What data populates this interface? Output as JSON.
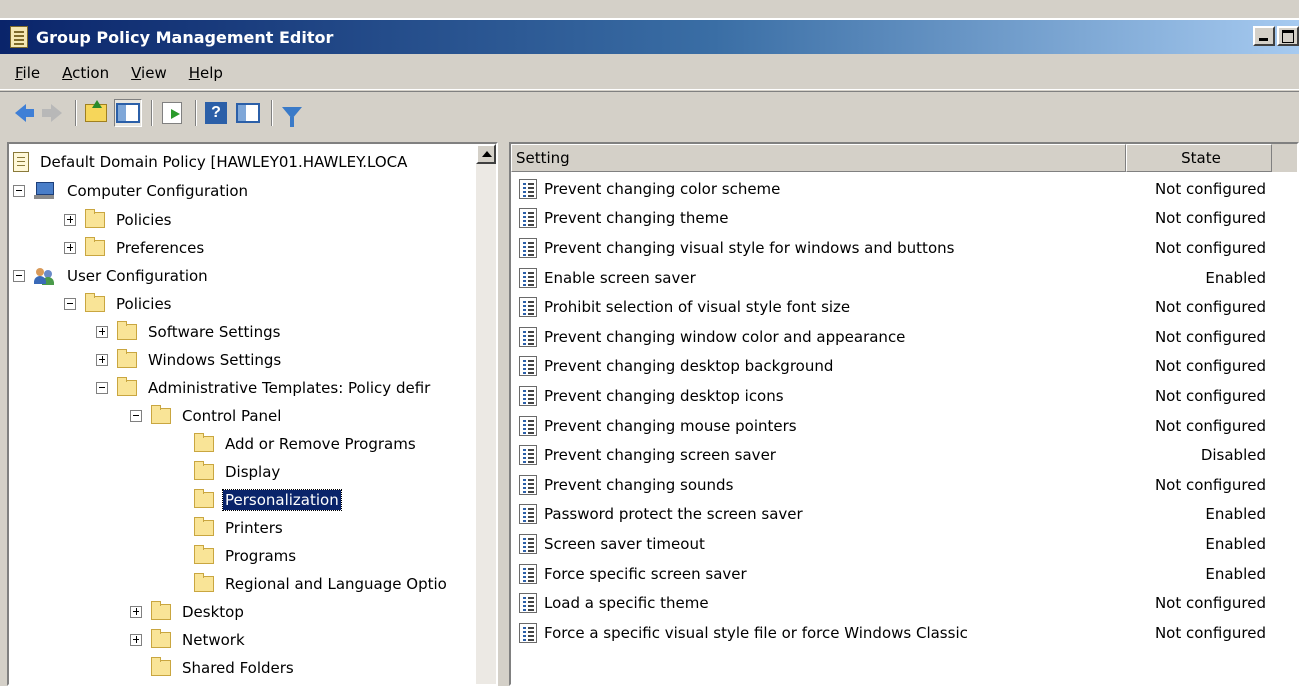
{
  "window": {
    "title": "Group Policy Management Editor"
  },
  "menu": [
    {
      "acc": "F",
      "rest": "ile"
    },
    {
      "acc": "A",
      "rest": "ction"
    },
    {
      "acc": "V",
      "rest": "iew"
    },
    {
      "acc": "H",
      "rest": "elp"
    }
  ],
  "toolbar": {
    "buttons": [
      "back-icon",
      "forward-icon",
      "up-one-level-icon",
      "show-hide-console-tree-icon",
      "export-list-icon",
      "help-icon",
      "show-hide-action-pane-icon",
      "filter-icon"
    ]
  },
  "tree": {
    "items": [
      {
        "label": "Default Domain Policy [HAWLEY01.HAWLEY.LOCA",
        "level": 0,
        "expander": "none",
        "icon": "policy-document-icon"
      },
      {
        "label": "Computer Configuration",
        "level": 0,
        "expander": "minus",
        "icon": "computer-icon"
      },
      {
        "label": "Policies",
        "level": 1,
        "expander": "plus",
        "icon": "folder-icon"
      },
      {
        "label": "Preferences",
        "level": 1,
        "expander": "plus",
        "icon": "folder-icon"
      },
      {
        "label": "User Configuration",
        "level": 0,
        "expander": "minus",
        "icon": "users-icon"
      },
      {
        "label": "Policies",
        "level": 1,
        "expander": "minus",
        "icon": "folder-icon"
      },
      {
        "label": "Software Settings",
        "level": 2,
        "expander": "plus",
        "icon": "folder-icon"
      },
      {
        "label": "Windows Settings",
        "level": 2,
        "expander": "plus",
        "icon": "folder-icon"
      },
      {
        "label": "Administrative Templates: Policy defir",
        "level": 2,
        "expander": "minus",
        "icon": "folder-icon"
      },
      {
        "label": "Control Panel",
        "level": 3,
        "expander": "minus",
        "icon": "folder-icon"
      },
      {
        "label": "Add or Remove Programs",
        "level": 4,
        "expander": "none",
        "icon": "folder-icon"
      },
      {
        "label": "Display",
        "level": 4,
        "expander": "none",
        "icon": "folder-icon"
      },
      {
        "label": "Personalization",
        "level": 4,
        "expander": "none",
        "icon": "folder-icon",
        "selected": true
      },
      {
        "label": "Printers",
        "level": 4,
        "expander": "none",
        "icon": "folder-icon"
      },
      {
        "label": "Programs",
        "level": 4,
        "expander": "none",
        "icon": "folder-icon"
      },
      {
        "label": "Regional and Language Optio",
        "level": 4,
        "expander": "none",
        "icon": "folder-icon"
      },
      {
        "label": "Desktop",
        "level": 3,
        "expander": "plus",
        "icon": "folder-icon"
      },
      {
        "label": "Network",
        "level": 3,
        "expander": "plus",
        "icon": "folder-icon"
      },
      {
        "label": "Shared Folders",
        "level": 3,
        "expander": "none",
        "icon": "folder-icon"
      }
    ]
  },
  "list": {
    "columns": {
      "setting": "Setting",
      "state": "State"
    },
    "rows": [
      {
        "setting": "Prevent changing color scheme",
        "state": "Not configured"
      },
      {
        "setting": "Prevent changing theme",
        "state": "Not configured"
      },
      {
        "setting": "Prevent changing visual style for windows and buttons",
        "state": "Not configured"
      },
      {
        "setting": "Enable screen saver",
        "state": "Enabled"
      },
      {
        "setting": "Prohibit selection of visual style font size",
        "state": "Not configured"
      },
      {
        "setting": "Prevent changing window color and appearance",
        "state": "Not configured"
      },
      {
        "setting": "Prevent changing desktop background",
        "state": "Not configured"
      },
      {
        "setting": "Prevent changing desktop icons",
        "state": "Not configured"
      },
      {
        "setting": "Prevent changing mouse pointers",
        "state": "Not configured"
      },
      {
        "setting": "Prevent changing screen saver",
        "state": "Disabled"
      },
      {
        "setting": "Prevent changing sounds",
        "state": "Not configured"
      },
      {
        "setting": "Password protect the screen saver",
        "state": "Enabled"
      },
      {
        "setting": "Screen saver timeout",
        "state": "Enabled"
      },
      {
        "setting": "Force specific screen saver",
        "state": "Enabled"
      },
      {
        "setting": "Load a specific theme",
        "state": "Not configured"
      },
      {
        "setting": "Force a specific visual style file or force Windows Classic",
        "state": "Not configured"
      }
    ]
  },
  "colors": {
    "titlebar": "#0a246a",
    "selection": "#0a246a",
    "chrome": "#d4d0c8"
  }
}
